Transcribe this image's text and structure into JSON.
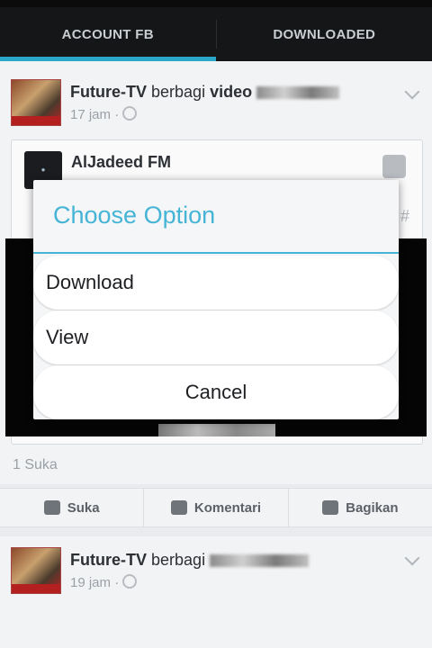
{
  "tabs": [
    {
      "label": "ACCOUNT FB",
      "active": true
    },
    {
      "label": "DOWNLOADED",
      "active": false
    }
  ],
  "post1": {
    "author": "Future-TV",
    "verb": "berbagi",
    "object": "video",
    "time": "17 jam ·",
    "shared_page": "AlJadeed FM",
    "likes": "1 Suka"
  },
  "actions": {
    "like": "Suka",
    "comment": "Komentari",
    "share": "Bagikan"
  },
  "post2": {
    "author": "Future-TV",
    "verb": "berbagi",
    "time": "19 jam ·"
  },
  "dialog": {
    "title": "Choose Option",
    "options": [
      "Download",
      "View"
    ],
    "cancel": "Cancel"
  },
  "colors": {
    "accent": "#45b4d6",
    "tab_indicator": "#2aa7c9"
  }
}
